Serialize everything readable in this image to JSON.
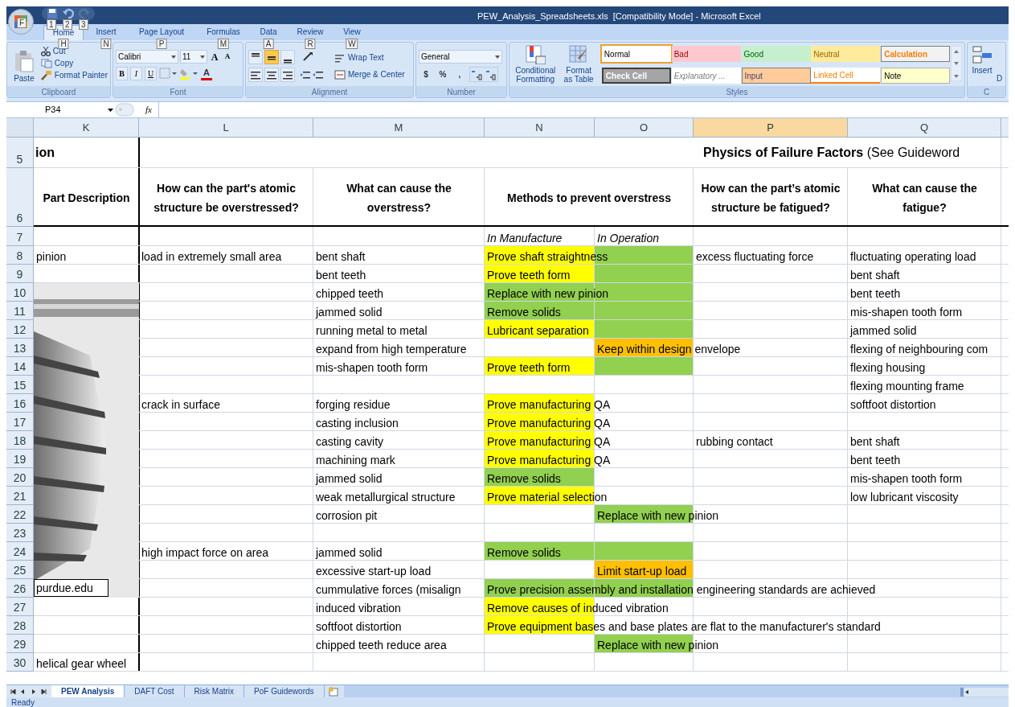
{
  "title_bar": {
    "title": "PEW_Analysis_Spreadsheets.xls  [Compatibility Mode] - Microsoft Excel"
  },
  "office_button": {
    "key_tip": "F"
  },
  "quick_access": [
    {
      "key_tip": "1",
      "kind": "save",
      "disabled": false
    },
    {
      "key_tip": "2",
      "kind": "undo",
      "disabled": false
    },
    {
      "key_tip": "3",
      "kind": "redo",
      "disabled": true
    }
  ],
  "ribbon_tabs": [
    {
      "label": "Home",
      "key_tip": "H",
      "selected": true
    },
    {
      "label": "Insert",
      "key_tip": "N",
      "selected": false
    },
    {
      "label": "Page Layout",
      "key_tip": "P",
      "selected": false
    },
    {
      "label": "Formulas",
      "key_tip": "M",
      "selected": false
    },
    {
      "label": "Data",
      "key_tip": "A",
      "selected": false
    },
    {
      "label": "Review",
      "key_tip": "R",
      "selected": false
    },
    {
      "label": "View",
      "key_tip": "W",
      "selected": false
    }
  ],
  "clipboard": {
    "paste": "Paste",
    "cut": "Cut",
    "copy": "Copy",
    "format_painter": "Format Painter",
    "label": "Clipboard"
  },
  "font": {
    "name": "Calibri",
    "size": "11",
    "size_buttons": [
      "A",
      "A"
    ],
    "format_buttons": [
      "B",
      "I",
      "U"
    ],
    "font_color": "A",
    "label": "Font"
  },
  "alignment": {
    "vertical": [
      {
        "selected": false
      },
      {
        "selected": true
      },
      {
        "selected": false
      }
    ],
    "wrap_text": "Wrap Text",
    "merge_center": "Merge & Center",
    "label": "Alignment"
  },
  "number": {
    "format": "General",
    "symbols": [
      "$",
      "%",
      ","
    ],
    "label": "Number"
  },
  "styles": {
    "conditional_formatting": "Conditional Formatting",
    "format_as_table": "Format as Table",
    "label": "Styles",
    "cells": [
      {
        "label": "Normal",
        "kind": "normal",
        "selected": true
      },
      {
        "label": "Bad",
        "kind": "bad",
        "selected": false
      },
      {
        "label": "Good",
        "kind": "good",
        "selected": false
      },
      {
        "label": "Neutral",
        "kind": "neutral",
        "selected": false
      },
      {
        "label": "Calculation",
        "kind": "calculation",
        "selected": false
      },
      {
        "label": "Check Cell",
        "kind": "check",
        "selected": false
      },
      {
        "label": "Explanatory ...",
        "kind": "explanatory",
        "selected": false
      },
      {
        "label": "Input",
        "kind": "input",
        "selected": false
      },
      {
        "label": "Linked Cell",
        "kind": "linked",
        "selected": false
      },
      {
        "label": "Note",
        "kind": "note",
        "selected": false
      }
    ]
  },
  "cells_group": {
    "insert": "Insert",
    "next": "D",
    "label": "C"
  },
  "formula_bar": {
    "name_box": "P34",
    "fx": "fx"
  },
  "columns": [
    {
      "label": "K",
      "selected": false
    },
    {
      "label": "L",
      "selected": false
    },
    {
      "label": "M",
      "selected": false
    },
    {
      "label": "N",
      "selected": false
    },
    {
      "label": "O",
      "selected": false
    },
    {
      "label": "P",
      "selected": true
    },
    {
      "label": "Q",
      "selected": false
    }
  ],
  "rows": [
    {
      "num": "5",
      "kind": "title",
      "cells": {
        "K": {
          "text": "ion"
        },
        "P": {
          "text": "**Physics of Failure Factors** (See Guideword"
        }
      }
    },
    {
      "num": "6",
      "kind": "header",
      "cells": {
        "K": {
          "text": "Part Description"
        },
        "L": {
          "text": "How can the part's atomic structure be overstressed?"
        },
        "M": {
          "text": "What can cause the overstress?"
        },
        "N": {
          "text": "Methods to prevent overstress",
          "merged": true
        },
        "P": {
          "text": "How can the part’s atomic structure be fatigued?"
        },
        "Q": {
          "text": "What can cause the fatigue?"
        }
      }
    },
    {
      "num": "7",
      "kind": "sub",
      "cells": {
        "N": {
          "text": "In Manufacture"
        },
        "O": {
          "text": "In Operation"
        }
      }
    },
    {
      "num": "8",
      "kind": "data",
      "cells": {
        "K": {
          "text": "pinion"
        },
        "L": {
          "text": "load in extremely small area"
        },
        "M": {
          "text": "bent shaft"
        },
        "N": {
          "text": "Prove shaft straightness",
          "color": "#ffff00"
        },
        "O": {
          "color": "#92d050"
        },
        "P": {
          "text": "excess fluctuating force"
        },
        "Q": {
          "text": "fluctuating operating load"
        }
      }
    },
    {
      "num": "9",
      "kind": "data",
      "cells": {
        "M": {
          "text": "bent teeth"
        },
        "N": {
          "text": "Prove teeth form",
          "color": "#ffff00"
        },
        "O": {
          "color": "#92d050"
        },
        "Q": {
          "text": "bent shaft"
        }
      }
    },
    {
      "num": "10",
      "kind": "data",
      "cells": {
        "M": {
          "text": "chipped teeth"
        },
        "N": {
          "text": "Replace with new pinion",
          "color": "#92d050"
        },
        "O": {
          "color": "#92d050"
        },
        "Q": {
          "text": "bent teeth"
        }
      }
    },
    {
      "num": "11",
      "kind": "data",
      "cells": {
        "M": {
          "text": "jammed solid"
        },
        "N": {
          "text": "Remove solids",
          "color": "#92d050"
        },
        "O": {
          "color": "#92d050"
        },
        "Q": {
          "text": "mis-shapen tooth form"
        }
      }
    },
    {
      "num": "12",
      "kind": "data",
      "cells": {
        "M": {
          "text": "running metal to metal"
        },
        "N": {
          "text": "Lubricant separation",
          "color": "#ffff00"
        },
        "O": {
          "color": "#92d050"
        },
        "Q": {
          "text": "jammed solid"
        }
      }
    },
    {
      "num": "13",
      "kind": "data",
      "cells": {
        "M": {
          "text": "expand from high temperature"
        },
        "O": {
          "text": "Keep within design envelope",
          "color": "#ffc000"
        },
        "Q": {
          "text": "flexing of neighbouring com"
        }
      }
    },
    {
      "num": "14",
      "kind": "data",
      "cells": {
        "M": {
          "text": "mis-shapen tooth form"
        },
        "N": {
          "text": "Prove teeth form",
          "color": "#ffff00"
        },
        "O": {
          "color": "#92d050"
        },
        "Q": {
          "text": "flexing housing"
        }
      }
    },
    {
      "num": "15",
      "kind": "data",
      "cells": {
        "Q": {
          "text": "flexing mounting frame"
        }
      }
    },
    {
      "num": "16",
      "kind": "data",
      "cells": {
        "L": {
          "text": "crack in surface"
        },
        "M": {
          "text": "forging residue"
        },
        "N": {
          "text": "Prove manufacturing QA",
          "color": "#ffff00"
        },
        "Q": {
          "text": "softfoot distortion"
        }
      }
    },
    {
      "num": "17",
      "kind": "data",
      "cells": {
        "M": {
          "text": "casting inclusion"
        },
        "N": {
          "text": "Prove manufacturing QA",
          "color": "#ffff00"
        }
      }
    },
    {
      "num": "18",
      "kind": "data",
      "cells": {
        "M": {
          "text": "casting cavity"
        },
        "N": {
          "text": "Prove manufacturing QA",
          "color": "#ffff00"
        },
        "P": {
          "text": "rubbing contact"
        },
        "Q": {
          "text": "bent shaft"
        }
      }
    },
    {
      "num": "19",
      "kind": "data",
      "cells": {
        "M": {
          "text": "machining mark"
        },
        "N": {
          "text": "Prove manufacturing QA",
          "color": "#ffff00"
        },
        "Q": {
          "text": "bent teeth"
        }
      }
    },
    {
      "num": "20",
      "kind": "data",
      "cells": {
        "M": {
          "text": "jammed solid"
        },
        "N": {
          "text": "Remove solids",
          "color": "#92d050"
        },
        "Q": {
          "text": "mis-shapen tooth form"
        }
      }
    },
    {
      "num": "21",
      "kind": "data",
      "cells": {
        "M": {
          "text": "weak metallurgical structure"
        },
        "N": {
          "text": "Prove material selection",
          "color": "#ffff00"
        },
        "Q": {
          "text": "low lubricant viscosity"
        }
      }
    },
    {
      "num": "22",
      "kind": "data",
      "cells": {
        "M": {
          "text": "corrosion pit"
        },
        "O": {
          "text": "Replace with new pinion",
          "color": "#92d050"
        }
      }
    },
    {
      "num": "23",
      "kind": "data"
    },
    {
      "num": "24",
      "kind": "data",
      "cells": {
        "L": {
          "text": "high impact force on area"
        },
        "M": {
          "text": "jammed solid"
        },
        "N": {
          "text": "Remove solids",
          "color": "#92d050"
        },
        "O": {
          "color": "#92d050"
        }
      }
    },
    {
      "num": "25",
      "kind": "data",
      "cells": {
        "M": {
          "text": "excessive start-up load"
        },
        "O": {
          "text": "Limit start-up load",
          "color": "#ffc000"
        }
      }
    },
    {
      "num": "26",
      "kind": "data",
      "cells": {
        "M": {
          "text": "cummulative forces (misalign"
        },
        "N": {
          "text": "Prove precision assembly and installation engineering standards are achieved",
          "color": "#92d050"
        },
        "O": {
          "color": "#92d050"
        }
      }
    },
    {
      "num": "27",
      "kind": "data",
      "cells": {
        "M": {
          "text": "induced vibration"
        },
        "N": {
          "text": "Remove causes of induced vibration",
          "color": "#ffff00"
        }
      }
    },
    {
      "num": "28",
      "kind": "data",
      "cells": {
        "M": {
          "text": "softfoot distortion"
        },
        "N": {
          "text": "Prove equipment bases and base plates are flat to the manufacturer's standard",
          "color": "#ffff00"
        }
      }
    },
    {
      "num": "29",
      "kind": "data",
      "cells": {
        "M": {
          "text": "chipped teeth reduce area"
        },
        "O": {
          "text": "Replace with new pinion",
          "color": "#92d050"
        }
      }
    },
    {
      "num": "30",
      "kind": "data",
      "cells": {
        "K": {
          "text": "helical gear wheel"
        }
      }
    }
  ],
  "picture": {
    "kind": "picture",
    "caption": "purdue.edu"
  },
  "sheet_tabs": [
    {
      "label": "PEW Analysis",
      "selected": true
    },
    {
      "label": "DAFT Cost",
      "selected": false
    },
    {
      "label": "Risk Matrix",
      "selected": false
    },
    {
      "label": "PoF Guidewords",
      "selected": false
    }
  ],
  "status_bar": {
    "text": "Ready"
  }
}
